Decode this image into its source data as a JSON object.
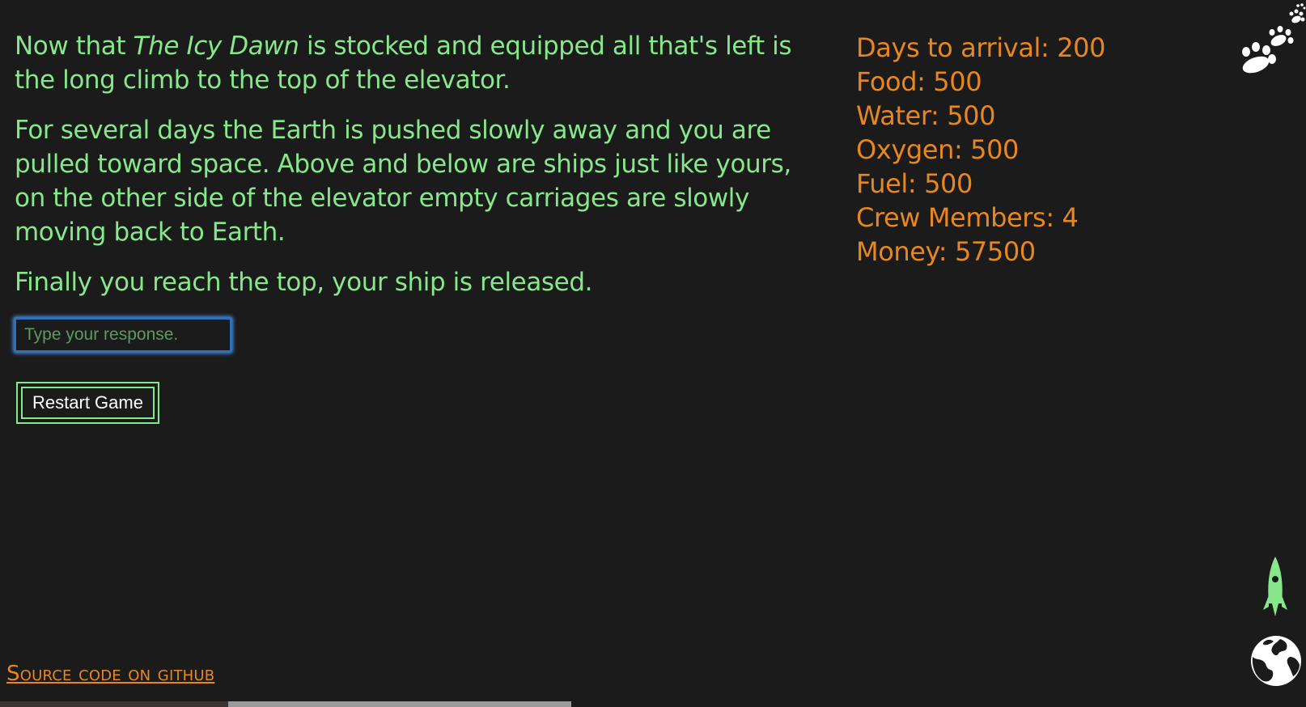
{
  "story": {
    "p1_before": "Now that ",
    "ship_name": "The Icy Dawn",
    "p1_after": " is stocked and equipped all that's left is the long climb to the top of the elevator.",
    "p2": "For several days the Earth is pushed slowly away and you are pulled toward space. Above and below are ships just like yours, on the other side of the elevator empty carriages are slowly moving back to Earth.",
    "p3": "Finally you reach the top, your ship is released."
  },
  "response": {
    "placeholder": "Type your response.",
    "value": ""
  },
  "restart_label": "Restart Game",
  "stats": [
    {
      "label": "Days to arrival",
      "value": "200"
    },
    {
      "label": "Food",
      "value": "500"
    },
    {
      "label": "Water",
      "value": "500"
    },
    {
      "label": "Oxygen",
      "value": "500"
    },
    {
      "label": "Fuel",
      "value": "500"
    },
    {
      "label": "Crew Members",
      "value": "4"
    },
    {
      "label": "Money",
      "value": "57500"
    }
  ],
  "footer": {
    "source_link": "Source code on github"
  },
  "icons": {
    "top_right": "paw-prints-icon",
    "ship": "rocket-icon",
    "planet": "globe-icon"
  },
  "colors": {
    "background": "#1b1b1b",
    "story_text": "#86e88a",
    "stats_text": "#e8871e",
    "input_border": "#2f70b8"
  }
}
